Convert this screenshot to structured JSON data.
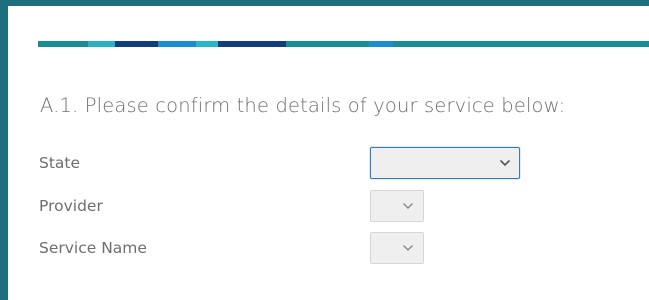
{
  "question": {
    "text": "A.1. Please confirm the details of your service below:"
  },
  "fields": [
    {
      "label": "State",
      "value": "",
      "icon": "chevron-down-icon"
    },
    {
      "label": "Provider",
      "value": "",
      "icon": "chevron-down-icon"
    },
    {
      "label": "Service Name",
      "value": "",
      "icon": "chevron-down-icon"
    }
  ],
  "colors": {
    "frame": "#1f6e80",
    "stripe": [
      "#1a8c93",
      "#2ab0c2",
      "#0f3e78",
      "#1a8ed0",
      "#27b7c6",
      "#0f3e78",
      "#1a8c93",
      "#1a8ed0",
      "#1a8c93"
    ],
    "focus": "#2f7bc4",
    "text": "#6e6e6e"
  }
}
